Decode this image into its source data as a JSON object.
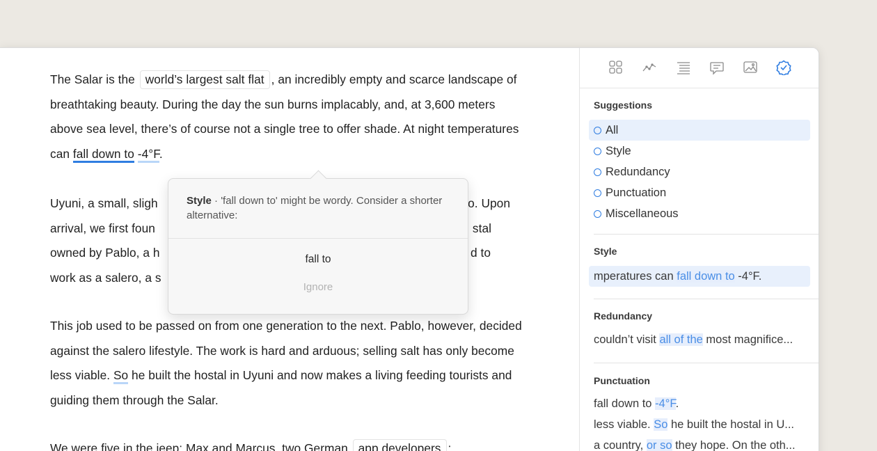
{
  "editor": {
    "p1": {
      "a": "The Salar is the ",
      "chip": "world’s largest salt flat",
      "b": ", an incredibly empty and scarce landscape of breathtaking beauty. During the day the sun burns implacably, and, at 3,600 meters above sea level, there’s of course not a single tree to offer shade. At night temperatures can ",
      "flagged": "fall down to",
      "c": " ",
      "flagged2": "-4°F",
      "d": "."
    },
    "p2": {
      "l1a": "Uyuni, a small, sligh",
      "l1b": "o. Upon",
      "l2a": "arrival, we first foun",
      "l2b": "stal",
      "l3a": "owned by Pablo, a h",
      "l3b": "d to",
      "l4a": "work as a salero, a s"
    },
    "p3": {
      "a": "This job used to be passed on from one generation to the next. Pablo, however, decided against the salero lifestyle. The work is hard and arduous; selling salt has only become less viable. ",
      "flagged": "So",
      "b": " he built the hostal in Uyuni and now makes a living feeding tourists and guiding them through the Salar."
    },
    "p4": {
      "a": "We were five in the jeep: Max and Marcus, two German ",
      "chip": "app developers",
      "b": ";"
    }
  },
  "popover": {
    "category": "Style",
    "message": " · 'fall down to' might be wordy. Consider a shorter alternative:",
    "suggestion": "fall to",
    "ignore": "Ignore"
  },
  "sidebar": {
    "tabs": [
      "overview-icon",
      "stats-icon",
      "outline-icon",
      "comments-icon",
      "image-icon",
      "checkmark-badge-icon"
    ],
    "suggestions_title": "Suggestions",
    "filters": [
      "All",
      "Style",
      "Redundancy",
      "Punctuation",
      "Miscellaneous"
    ],
    "style_title": "Style",
    "style_snip": {
      "a": "mperatures can ",
      "hl": "fall down to",
      "b": " -4°F."
    },
    "redundancy_title": "Redundancy",
    "redundancy_snip": {
      "a": "couldn’t visit ",
      "hl": "all of the",
      "b": " most magnifice..."
    },
    "punctuation_title": "Punctuation",
    "punct_snips": [
      {
        "a": "fall down to ",
        "hl": "-4°F",
        "b": "."
      },
      {
        "a": "less viable. ",
        "hl": "So",
        "b": " he built the hostal in U..."
      },
      {
        "a": "a country, ",
        "hl": "or so",
        "b": " they hope. On the oth..."
      }
    ]
  },
  "colors": {
    "accent": "#2f7de1",
    "highlight_bg": "#e6eefc",
    "background": "#ece9e3"
  }
}
